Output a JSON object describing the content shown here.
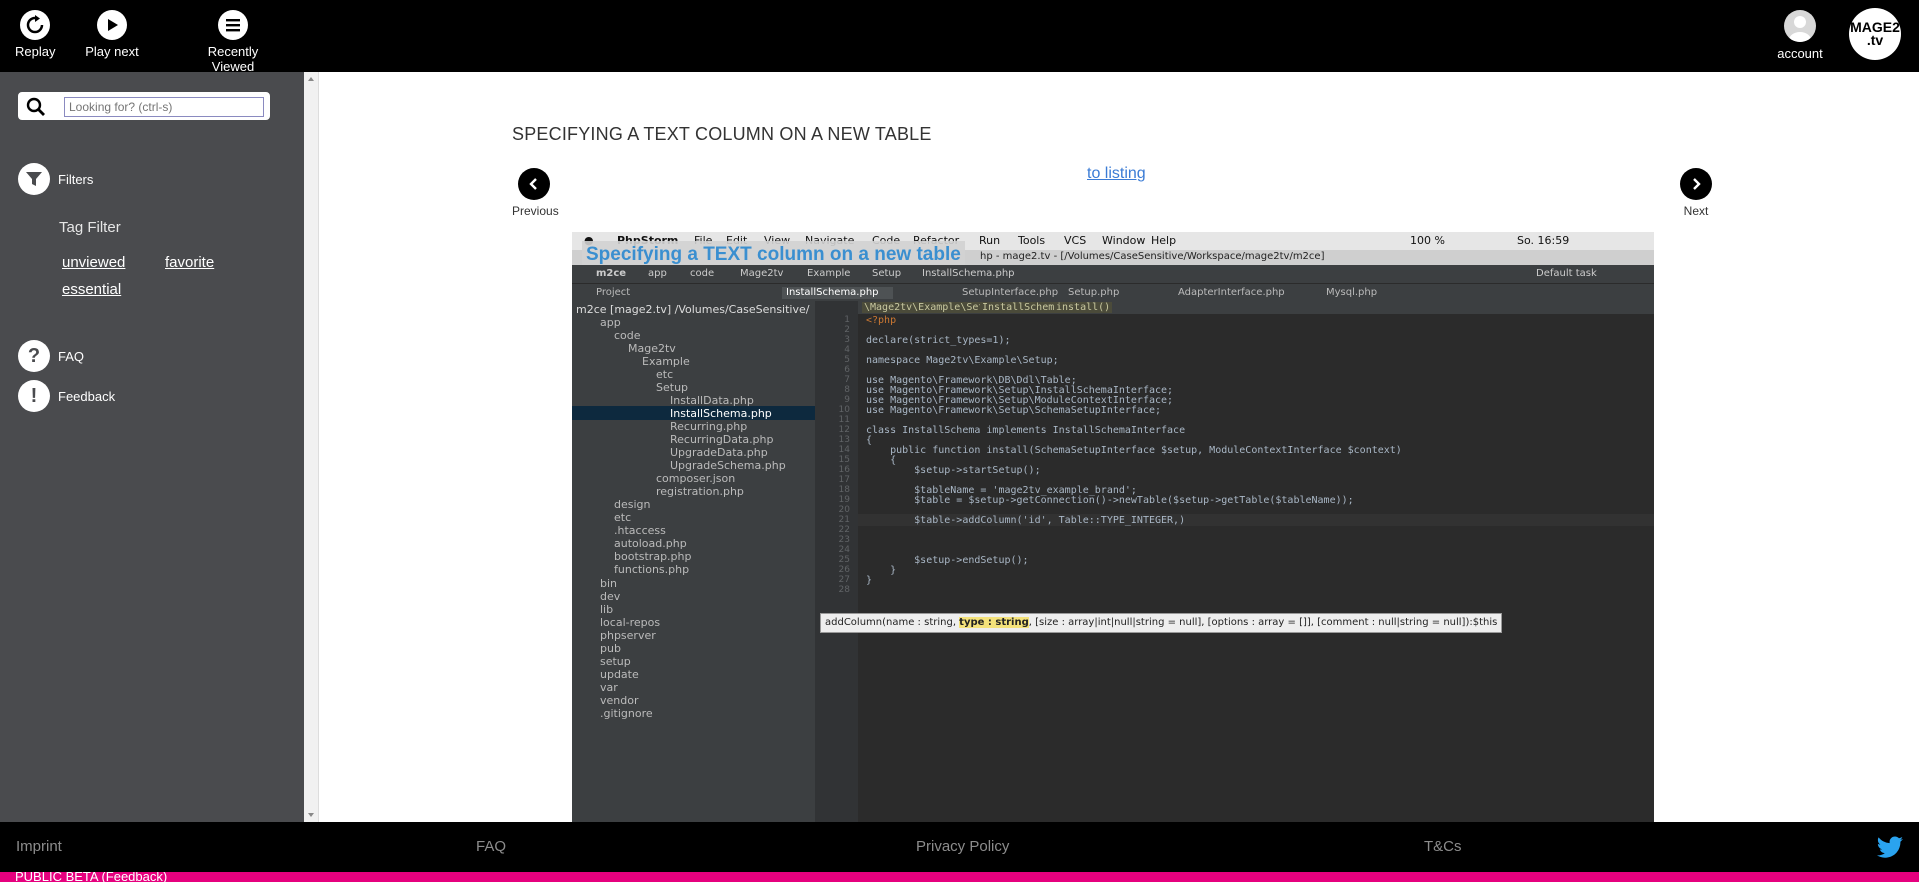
{
  "topbar": {
    "replay": "Replay",
    "play_next": "Play next",
    "recently_viewed": "Recently Viewed",
    "account": "account",
    "logo_line1": "MAGE2",
    "logo_line2": ".tv"
  },
  "sidebar": {
    "search_placeholder": "Looking for? (ctrl-s)",
    "filters": "Filters",
    "tag_filter": "Tag Filter",
    "tags": [
      "unviewed",
      "favorite",
      "essential"
    ],
    "faq": "FAQ",
    "feedback": "Feedback"
  },
  "main": {
    "title": "SPECIFYING A TEXT COLUMN ON A NEW TABLE",
    "to_listing": "to listing",
    "previous": "Previous",
    "next": "Next"
  },
  "video": {
    "overlay_title": "Specifying a TEXT column on a new table",
    "mac_menu": [
      "PhpStorm",
      "File",
      "Edit",
      "View",
      "Navigate",
      "Code",
      "Refactor",
      "Run",
      "Tools",
      "VCS",
      "Window",
      "Help"
    ],
    "mac_battery": "100 %",
    "mac_clock": "So. 16:59",
    "window_title": "hp - mage2.tv - [/Volumes/CaseSensitive/Workspace/mage2tv/m2ce]",
    "crumbs": [
      "m2ce",
      "app",
      "code",
      "Mage2tv",
      "Example",
      "Setup",
      "InstallSchema.php"
    ],
    "run_config": "Default task",
    "project_label": "Project",
    "tabs": [
      "InstallSchema.php",
      "SetupInterface.php",
      "Setup.php",
      "AdapterInterface.php",
      "Mysql.php"
    ],
    "editor_crumbs": [
      "\\Mage2tv\\Example\\Setup",
      "InstallSchema",
      "install()"
    ],
    "tree": [
      "m2ce [mage2.tv] /Volumes/CaseSensitive/",
      "app",
      "code",
      "Mage2tv",
      "Example",
      "etc",
      "Setup",
      "InstallData.php",
      "InstallSchema.php",
      "Recurring.php",
      "RecurringData.php",
      "UpgradeData.php",
      "UpgradeSchema.php",
      "composer.json",
      "registration.php",
      "design",
      "etc",
      ".htaccess",
      "autoload.php",
      "bootstrap.php",
      "functions.php",
      "bin",
      "dev",
      "lib",
      "local-repos",
      "phpserver",
      "pub",
      "setup",
      "update",
      "var",
      "vendor",
      ".gitignore"
    ],
    "line_numbers": [
      "1",
      "2",
      "3",
      "4",
      "5",
      "6",
      "7",
      "8",
      "9",
      "10",
      "11",
      "12",
      "13",
      "14",
      "15",
      "16",
      "17",
      "18",
      "19",
      "20",
      "21",
      "22",
      "23",
      "24",
      "25",
      "26",
      "27",
      "28"
    ],
    "code": [
      "<?php",
      "",
      "declare(strict_types=1);",
      "",
      "namespace Mage2tv\\Example\\Setup;",
      "",
      "use Magento\\Framework\\DB\\Ddl\\Table;",
      "use Magento\\Framework\\Setup\\InstallSchemaInterface;",
      "use Magento\\Framework\\Setup\\ModuleContextInterface;",
      "use Magento\\Framework\\Setup\\SchemaSetupInterface;",
      "",
      "class InstallSchema implements InstallSchemaInterface",
      "{",
      "    public function install(SchemaSetupInterface $setup, ModuleContextInterface $context)",
      "    {",
      "        $setup->startSetup();",
      "",
      "        $tableName = 'mage2tv_example_brand';",
      "        $table = $setup->getConnection()->newTable($setup->getTable($tableName));",
      "",
      "        $table->addColumn('id', Table::TYPE_INTEGER,)",
      "",
      "",
      "",
      "        $setup->endSetup();",
      "    }",
      "}",
      ""
    ],
    "tooltip_pre": "addColumn(name : string, ",
    "tooltip_bold": "type : string",
    "tooltip_post": ", [size : array|int|null|string = null], [options : array = []], [comment : null|string = null]):$this"
  },
  "footer": {
    "imprint": "Imprint",
    "faq": "FAQ",
    "privacy": "Privacy Policy",
    "tcs": "T&Cs",
    "beta": "PUBLIC BETA (Feedback)"
  },
  "colors": {
    "accent_blue": "#3a7bd5",
    "beta_pink": "#e6007e",
    "sidebar_bg": "#4a4b4e"
  }
}
